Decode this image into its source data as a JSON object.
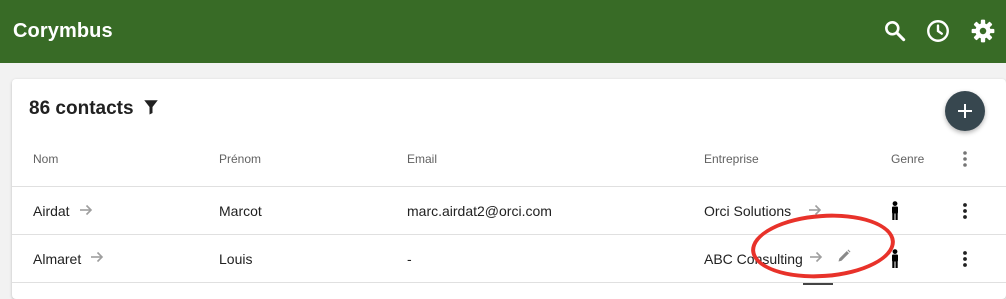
{
  "app": {
    "title": "Corymbus",
    "bar_color": "#386b26",
    "icons": [
      "search-icon",
      "history-icon",
      "settings-icon"
    ]
  },
  "list": {
    "title": "86 contacts",
    "filter_icon": "filter-icon",
    "add_icon": "plus-icon",
    "columns": [
      "Nom",
      "Prénom",
      "Email",
      "Entreprise",
      "Genre"
    ],
    "rows": [
      {
        "nom": "Airdat",
        "prenom": "Marcot",
        "email": "marc.airdat2@orci.com",
        "entreprise": "Orci Solutions",
        "genre": "male"
      },
      {
        "nom": "Almaret",
        "prenom": "Louis",
        "email": "-",
        "entreprise": "ABC Consulting",
        "genre": "male"
      }
    ]
  },
  "annotation_color": "#e8322a"
}
